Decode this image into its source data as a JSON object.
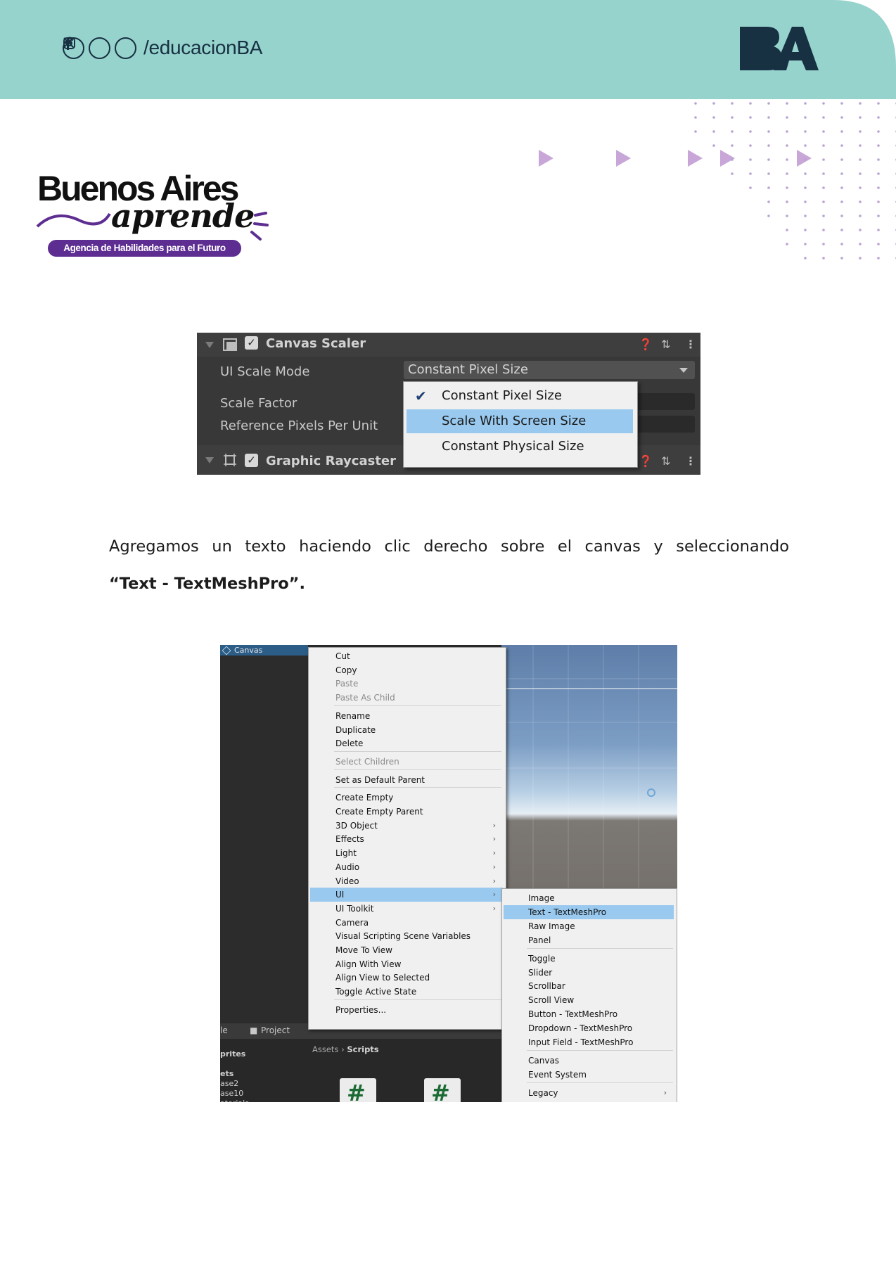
{
  "header": {
    "social_handle": "/educacionBA",
    "social_icons": [
      "instagram-icon",
      "x-icon",
      "facebook-icon"
    ],
    "logo_text": "BA",
    "band_color": "#97d3cd",
    "logo_color": "#173042"
  },
  "brand": {
    "line1": "Buenos Aires",
    "line2": "aprende",
    "tagline": "Agencia de Habilidades para el Futuro",
    "accent_color": "#5d2d91"
  },
  "decor": {
    "arrow_color": "#c8a6d8",
    "dot_color": "#b9a3d3"
  },
  "canvas_scaler": {
    "title": "Canvas Scaler",
    "rows": [
      {
        "label": "UI Scale Mode"
      },
      {
        "label": "Scale Factor"
      },
      {
        "label": "Reference Pixels Per Unit"
      }
    ],
    "scale_mode_value": "Constant Pixel Size",
    "options": [
      {
        "label": "Constant Pixel Size",
        "checked": true
      },
      {
        "label": "Scale With Screen Size",
        "highlighted": true
      },
      {
        "label": "Constant Physical Size"
      }
    ],
    "next_component": "Graphic Raycaster"
  },
  "instruction": {
    "text": "Agregamos un texto haciendo clic derecho sobre el canvas y seleccionando",
    "highlight": "“Text - TextMeshPro”."
  },
  "unity_menu": {
    "hierarchy_item": "Canvas",
    "menu_items": [
      {
        "label": "Cut"
      },
      {
        "label": "Copy"
      },
      {
        "label": "Paste",
        "disabled": true
      },
      {
        "label": "Paste As Child",
        "disabled": true
      },
      {
        "label": "Rename"
      },
      {
        "label": "Duplicate"
      },
      {
        "label": "Delete"
      },
      {
        "label": "Select Children",
        "disabled": true
      },
      {
        "label": "Set as Default Parent"
      },
      {
        "label": "Create Empty"
      },
      {
        "label": "Create Empty Parent"
      },
      {
        "label": "3D Object",
        "submenu": true
      },
      {
        "label": "Effects",
        "submenu": true
      },
      {
        "label": "Light",
        "submenu": true
      },
      {
        "label": "Audio",
        "submenu": true
      },
      {
        "label": "Video",
        "submenu": true
      },
      {
        "label": "UI",
        "submenu": true,
        "highlighted": true
      },
      {
        "label": "UI Toolkit",
        "submenu": true
      },
      {
        "label": "Camera"
      },
      {
        "label": "Visual Scripting Scene Variables"
      },
      {
        "label": "Move To View"
      },
      {
        "label": "Align With View"
      },
      {
        "label": "Align View to Selected"
      },
      {
        "label": "Toggle Active State"
      },
      {
        "label": "Properties..."
      }
    ],
    "submenu_items": [
      {
        "label": "Image"
      },
      {
        "label": "Text - TextMeshPro",
        "highlighted": true
      },
      {
        "label": "Raw Image"
      },
      {
        "label": "Panel"
      },
      {
        "label": "Toggle"
      },
      {
        "label": "Slider"
      },
      {
        "label": "Scrollbar"
      },
      {
        "label": "Scroll View"
      },
      {
        "label": "Button - TextMeshPro"
      },
      {
        "label": "Dropdown - TextMeshPro"
      },
      {
        "label": "Input Field - TextMeshPro"
      },
      {
        "label": "Canvas"
      },
      {
        "label": "Event System"
      },
      {
        "label": "Legacy",
        "submenu": true
      }
    ],
    "bottom_tabs": [
      "le",
      "Project"
    ],
    "breadcrumb": [
      "Assets",
      "Scripts"
    ],
    "project_items": [
      "prites",
      "ets",
      "ase2",
      "ase10",
      "aterials"
    ],
    "script_icon": "#"
  }
}
